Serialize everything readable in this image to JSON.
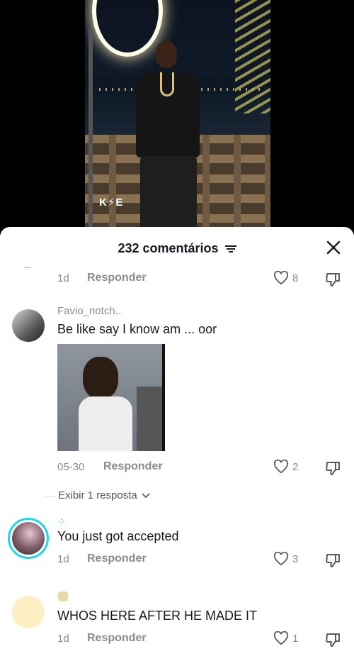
{
  "video": {
    "watermark": "K⚡E"
  },
  "sheet": {
    "title": "232 comentários",
    "close_icon": "close-icon",
    "filter_icon": "filter-icon"
  },
  "comments": [
    {
      "date": "1d",
      "reply_label": "Responder",
      "likes": "8"
    },
    {
      "username": "Favio_notch..",
      "text": "Be like say I know am ... oor",
      "date": "05-30",
      "reply_label": "Responder",
      "likes": "2",
      "view_replies": "Exibir 1 resposta"
    },
    {
      "username_icon": "paw-emoji",
      "text": "You just got accepted",
      "date": "1d",
      "reply_label": "Responder",
      "likes": "3"
    },
    {
      "username_icon": "face-emoji",
      "text": "WHOS HERE AFTER HE MADE IT",
      "date": "1d",
      "reply_label": "Responder",
      "likes": "1"
    }
  ],
  "colors": {
    "text": "#161823",
    "muted": "#8a8b91",
    "story_ring": "#20d5ec"
  }
}
